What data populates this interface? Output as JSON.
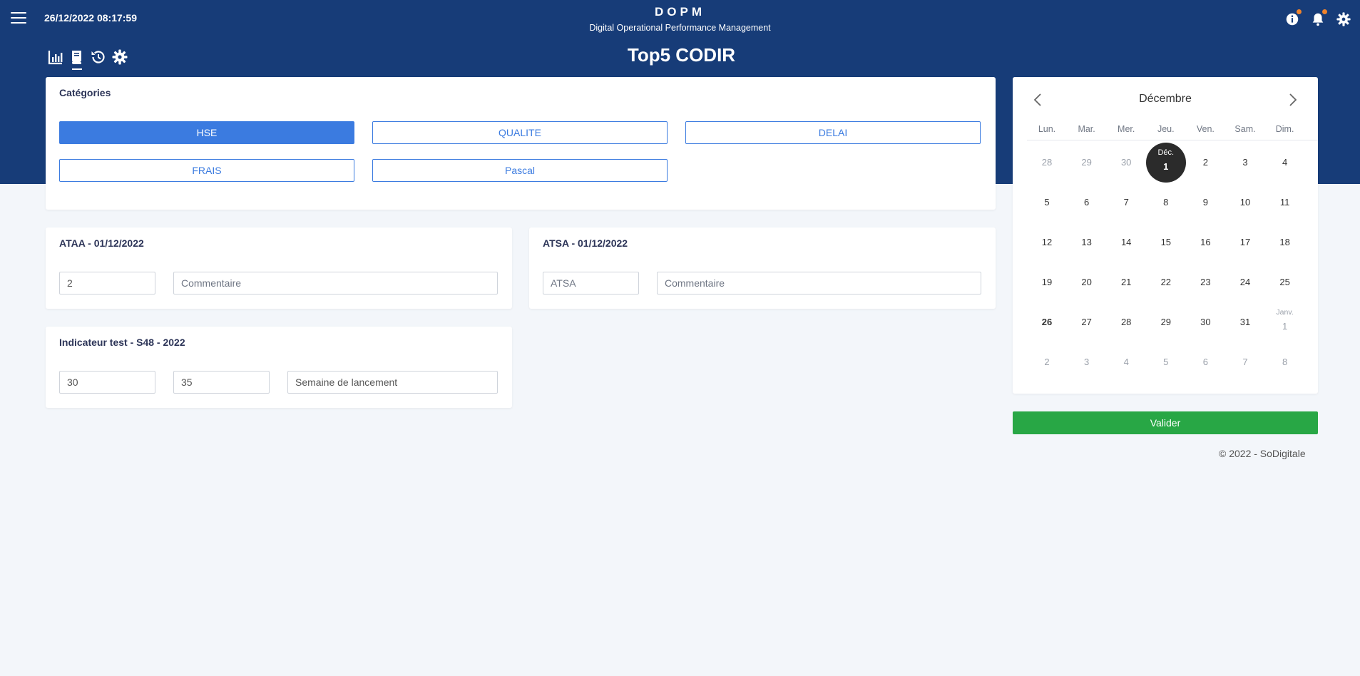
{
  "header": {
    "datetime": "26/12/2022 08:17:59",
    "app_title": "DOPM",
    "app_subtitle": "Digital Operational Performance Management",
    "page_title": "Top5 CODIR"
  },
  "categories": {
    "title": "Catégories",
    "items": [
      "HSE",
      "QUALITE",
      "DELAI",
      "FRAIS",
      "Pascal"
    ],
    "selected": "HSE"
  },
  "indicators": [
    {
      "title": "ATAA - 01/12/2022",
      "value": "2",
      "comment_placeholder": "Commentaire"
    },
    {
      "title": "ATSA - 01/12/2022",
      "value_placeholder": "ATSA",
      "comment_placeholder": "Commentaire"
    },
    {
      "title": "Indicateur test - S48 - 2022",
      "value1": "30",
      "value2": "35",
      "comment_placeholder": "Semaine de lancement"
    }
  ],
  "calendar": {
    "month": "Décembre",
    "weekdays": [
      "Lun.",
      "Mar.",
      "Mer.",
      "Jeu.",
      "Ven.",
      "Sam.",
      "Dim."
    ],
    "weeks": [
      [
        "28",
        "29",
        "30",
        "1",
        "2",
        "3",
        "4"
      ],
      [
        "5",
        "6",
        "7",
        "8",
        "9",
        "10",
        "11"
      ],
      [
        "12",
        "13",
        "14",
        "15",
        "16",
        "17",
        "18"
      ],
      [
        "19",
        "20",
        "21",
        "22",
        "23",
        "24",
        "25"
      ],
      [
        "26",
        "27",
        "28",
        "29",
        "30",
        "31",
        "1"
      ],
      [
        "2",
        "3",
        "4",
        "5",
        "6",
        "7",
        "8"
      ]
    ],
    "selected_label": "Déc.",
    "next_month_label": "Janv."
  },
  "actions": {
    "validate_label": "Valider"
  },
  "footer": {
    "copyright": "© 2022 - SoDigitale"
  },
  "colors": {
    "header_bg": "#173c78",
    "accent": "#3b7be0",
    "success": "#28a745",
    "badge": "#f0832b"
  }
}
